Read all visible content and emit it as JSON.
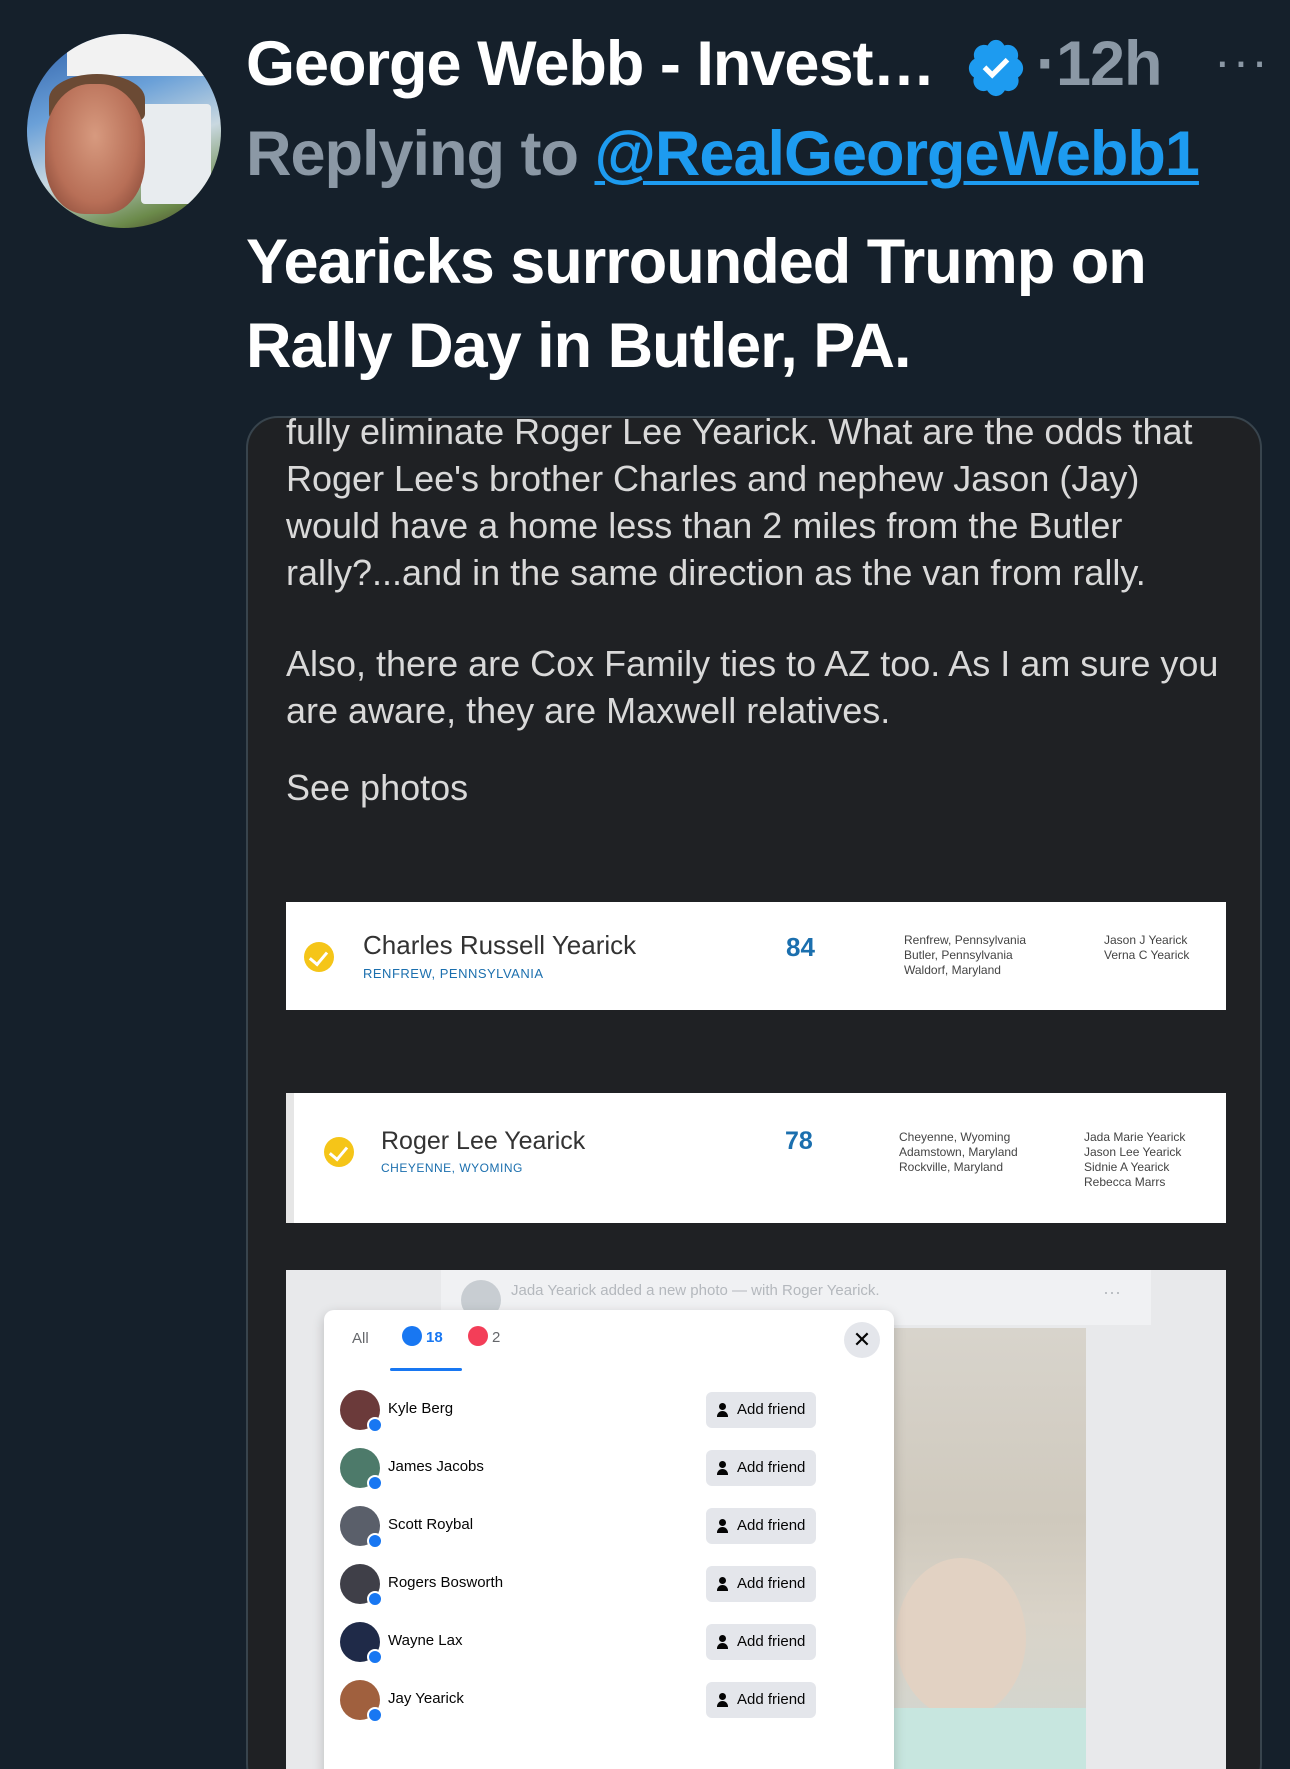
{
  "tweet": {
    "author_name": "George Webb - Invest…",
    "time": "12h",
    "separator": "·",
    "more": "···",
    "reply_prefix": "Replying to ",
    "reply_handle": "@RealGeorgeWebb1",
    "text": "Yearicks surrounded Trump on Rally Day in Butler, PA."
  },
  "document": {
    "paragraph1": "fully eliminate Roger Lee Yearick. What are the odds that Roger Lee's brother Charles and nephew Jason (Jay) would have a home less than 2 miles from the Butler rally?...and in the same direction as the van from rally.",
    "paragraph2": "Also, there are Cox Family ties to AZ too. As I am sure you are aware, they are Maxwell relatives.",
    "paragraph3": "See photos"
  },
  "records": [
    {
      "name": "Charles Russell Yearick",
      "location": "RENFREW, PENNSYLVANIA",
      "age": "84",
      "places": [
        "Renfrew, Pennsylvania",
        "Butler, Pennsylvania",
        "Waldorf, Maryland"
      ],
      "relatives": [
        "Jason J Yearick",
        "Verna C Yearick"
      ]
    },
    {
      "name": "Roger Lee Yearick",
      "location": "CHEYENNE, WYOMING",
      "age": "78",
      "places": [
        "Cheyenne, Wyoming",
        "Adamstown, Maryland",
        "Rockville, Maryland"
      ],
      "relatives": [
        "Jada Marie Yearick",
        "Jason Lee Yearick",
        "Sidnie A Yearick",
        "Rebecca Marrs"
      ]
    }
  ],
  "facebook": {
    "post_header": "Jada Yearick added a new photo — with Roger Yearick.",
    "post_more": "···",
    "tabs": {
      "all": "All",
      "likes": "18",
      "loves": "2"
    },
    "close": "✕",
    "people": [
      {
        "name": "Kyle Berg",
        "button": "Add friend"
      },
      {
        "name": "James Jacobs",
        "button": "Add friend"
      },
      {
        "name": "Scott Roybal",
        "button": "Add friend"
      },
      {
        "name": "Rogers Bosworth",
        "button": "Add friend"
      },
      {
        "name": "Wayne Lax",
        "button": "Add friend"
      },
      {
        "name": "Jay Yearick",
        "button": "Add friend"
      }
    ]
  },
  "colors": {
    "background": "#15202b",
    "accent_link": "#1d9bf0",
    "muted": "#8b98a5",
    "fb_blue": "#1877f2",
    "fb_love": "#f33e58",
    "verified_gold": "#f5c518"
  }
}
